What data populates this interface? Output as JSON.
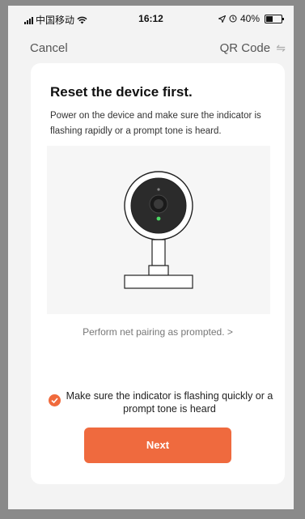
{
  "status_bar": {
    "carrier": "中国移动",
    "time": "16:12",
    "battery_percent": "40%"
  },
  "nav": {
    "cancel_label": "Cancel",
    "qr_label": "QR Code",
    "qr_icon_glyph": "⇋"
  },
  "card": {
    "title": "Reset the device first.",
    "description": "Power on the device and make sure the indicator is flashing rapidly or a prompt tone is heard.",
    "pairing_link": "Perform net pairing as prompted. >",
    "confirm_text": "Make sure the indicator is flashing quickly or a prompt tone is heard",
    "confirm_checked": true,
    "next_label": "Next"
  },
  "colors": {
    "accent": "#ef6a3e",
    "indicator_led": "#4cd964"
  },
  "icons": [
    "signal-icon",
    "wifi-icon",
    "location-arrow-icon",
    "alarm-icon",
    "battery-icon",
    "swap-icon",
    "check-icon",
    "camera-illustration"
  ]
}
